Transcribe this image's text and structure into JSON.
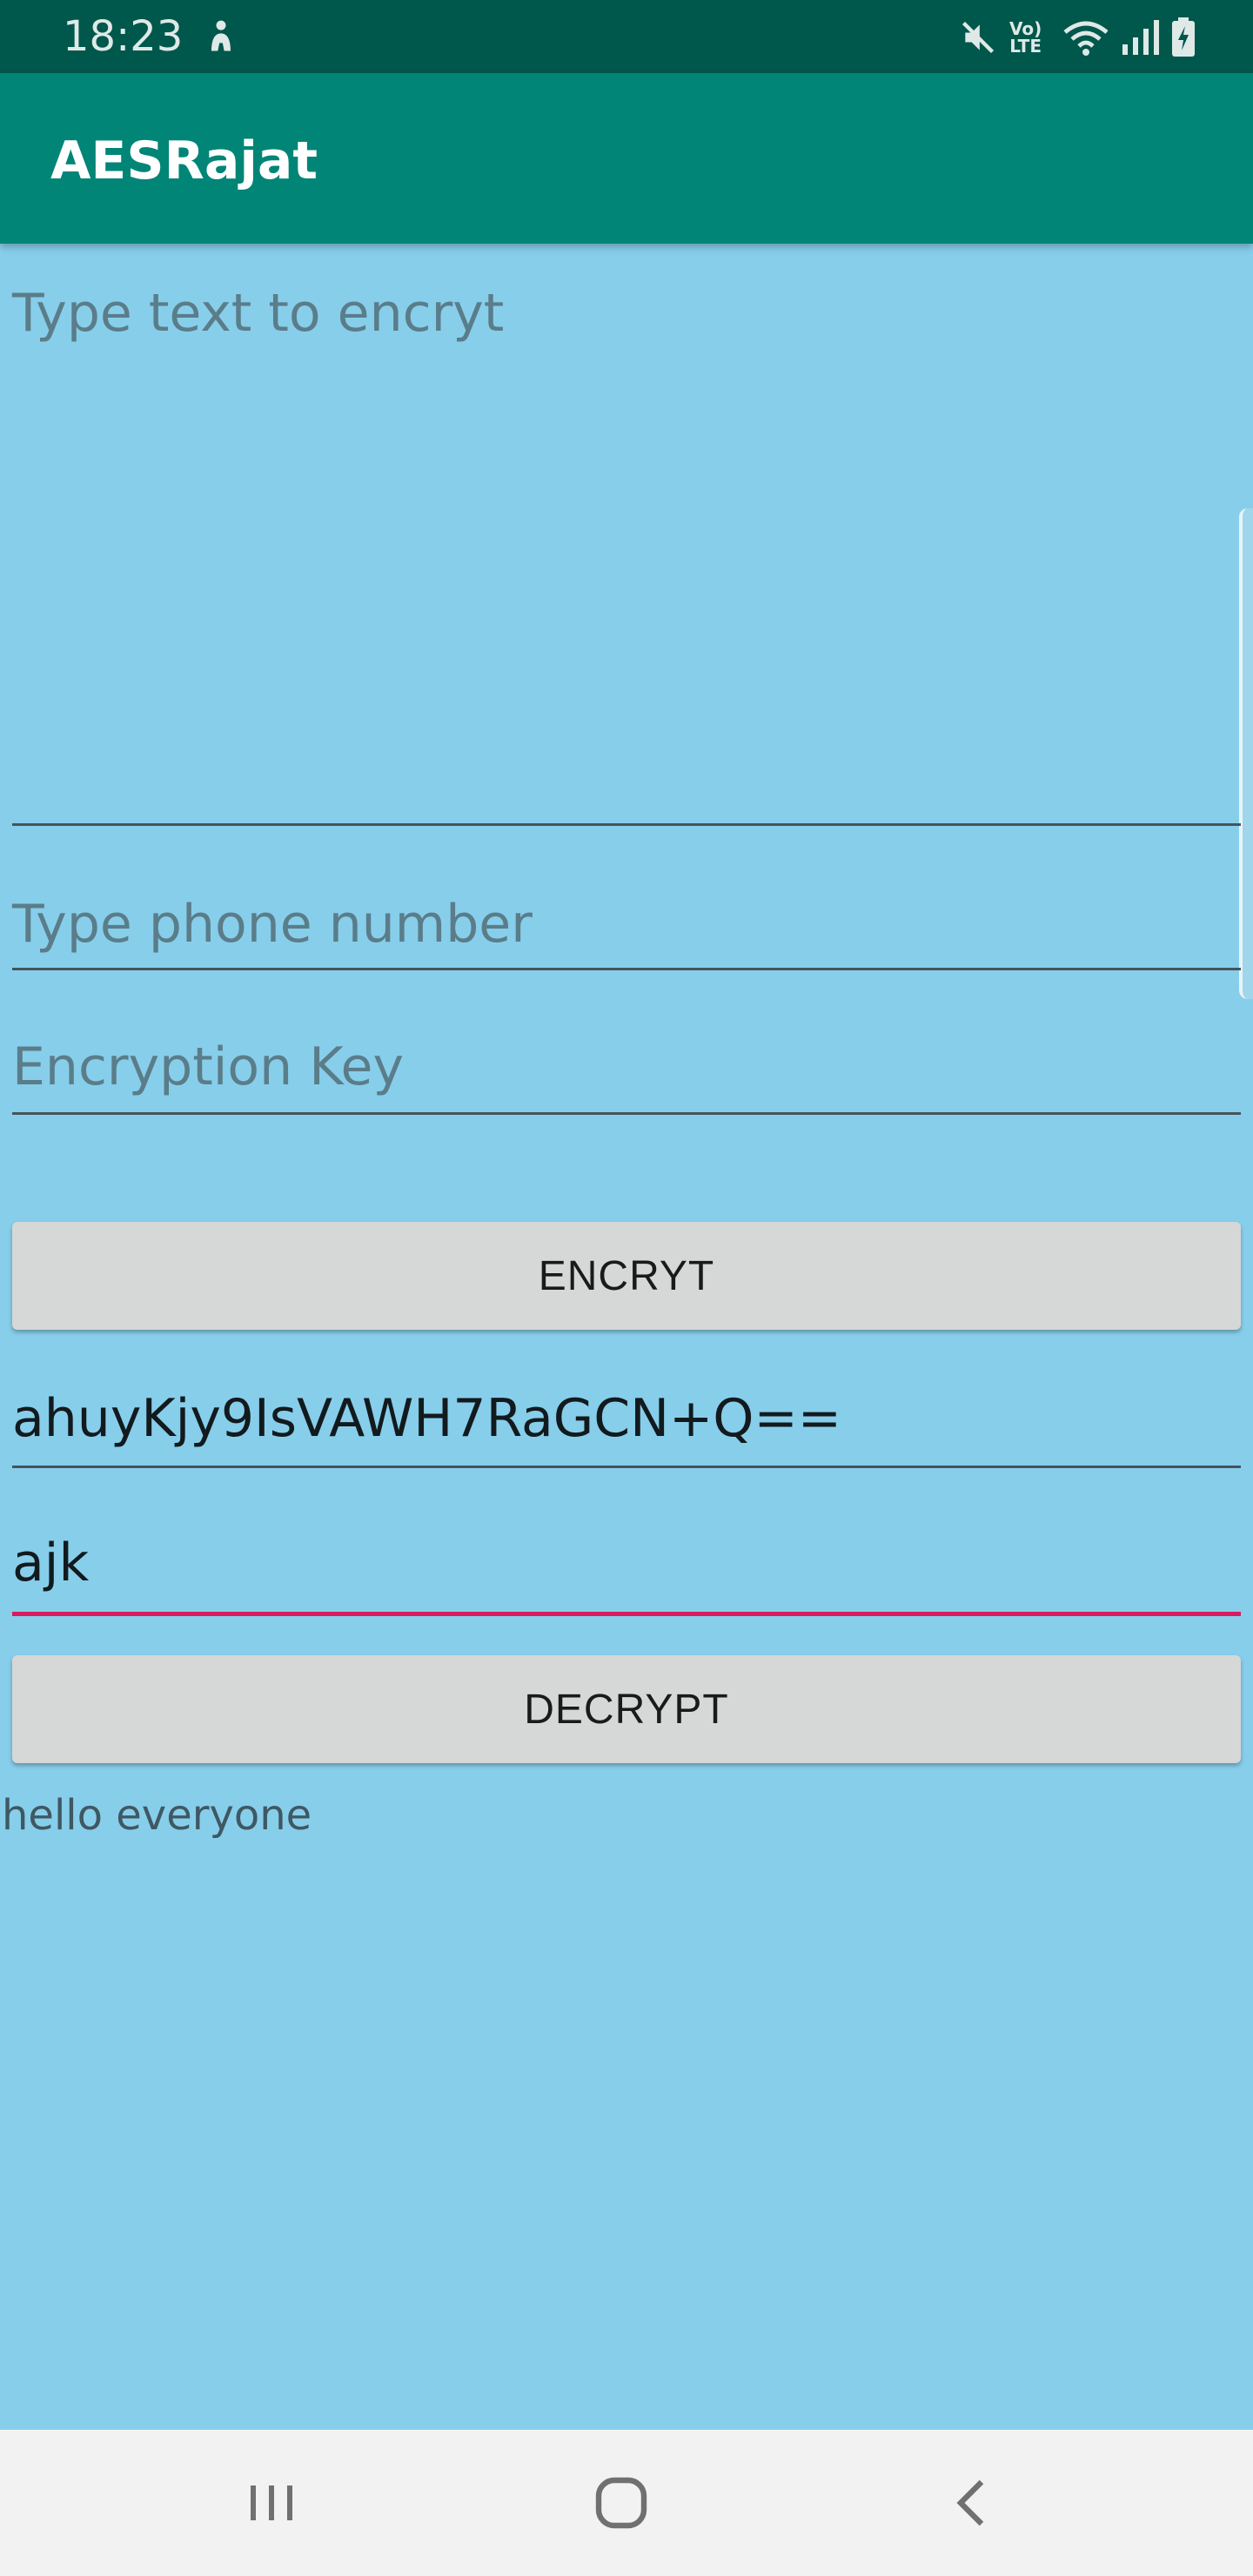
{
  "status_bar": {
    "time": "18:23",
    "icons": [
      "accessibility-icon",
      "mute-icon",
      "volte-icon",
      "wifi-icon",
      "signal-icon",
      "battery-charging-icon"
    ],
    "volte_top": "Vo)",
    "volte_bottom": "LTE"
  },
  "app_bar": {
    "title": "AESRajat",
    "color": "#008577"
  },
  "form": {
    "message_placeholder": "Type text to encryt",
    "phone_placeholder": "Type phone  number",
    "key_placeholder": "Encryption Key",
    "encrypt_label": "ENCRYT",
    "cipher_value": "ahuyKjy9IsVAWH7RaGCN+Q==",
    "decrypt_key_value": "ajk",
    "decrypt_label": "DECRYPT",
    "result_text": "hello everyone"
  },
  "colors": {
    "background": "#87CEEB",
    "status_bar": "#00574B",
    "focus_underline": "#D81B60",
    "button": "#D6D7D7"
  },
  "nav_bar": {
    "buttons": [
      "recent-apps-icon",
      "home-icon",
      "back-icon"
    ]
  }
}
